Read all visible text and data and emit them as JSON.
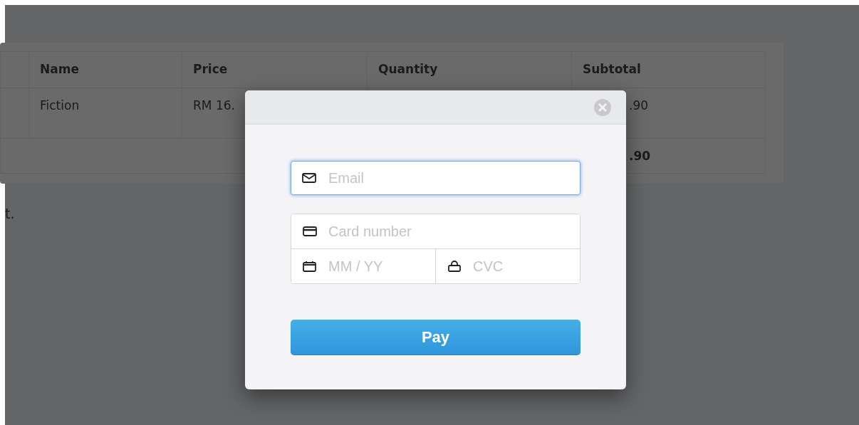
{
  "table": {
    "columns": [
      "Name",
      "Price",
      "Quantity",
      "Subtotal"
    ],
    "rows": [
      {
        "name": "Fiction",
        "price": "RM 16.",
        "subtotal": ".90"
      }
    ],
    "total": ".90"
  },
  "note": "t.",
  "modal": {
    "email": {
      "placeholder": "Email",
      "focused": true
    },
    "card_number": {
      "placeholder": "Card number"
    },
    "expiry": {
      "placeholder": "MM / YY"
    },
    "cvc": {
      "placeholder": "CVC"
    },
    "pay_button": "Pay"
  }
}
